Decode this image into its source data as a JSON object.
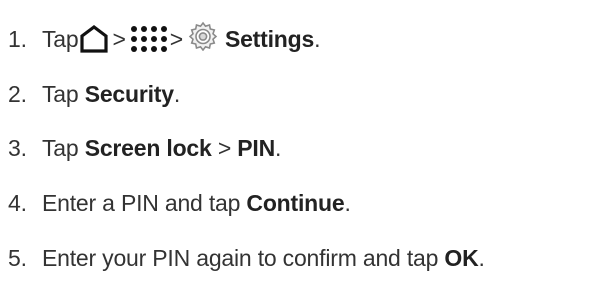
{
  "steps": [
    {
      "number": "1.",
      "text_a": "Tap",
      "sep1": ">",
      "sep2": ">",
      "bold": "Settings",
      "end": ".",
      "icons": [
        "home-icon",
        "apps-grid-icon",
        "settings-gear-icon"
      ]
    },
    {
      "number": "2.",
      "text_a": "Tap ",
      "bold": "Security",
      "end": "."
    },
    {
      "number": "3.",
      "text_a": "Tap ",
      "bold": "Screen lock",
      "text_b": " > ",
      "bold2": "PIN",
      "end": "."
    },
    {
      "number": "4.",
      "text_a": "Enter a PIN and tap ",
      "bold": "Continue",
      "end": "."
    },
    {
      "number": "5.",
      "text_a": "Enter your PIN again to confirm and tap ",
      "bold": "OK",
      "end": "."
    }
  ]
}
